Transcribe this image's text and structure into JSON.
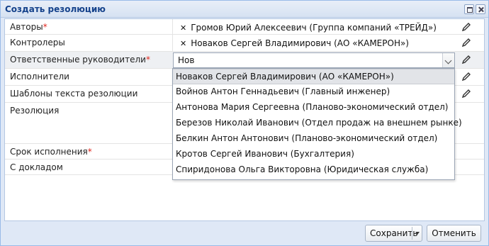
{
  "window": {
    "title": "Создать резолюцию"
  },
  "form": {
    "rows": [
      {
        "label": "Авторы",
        "required": true,
        "value": "Громов Юрий Алексеевич (Группа компаний «ТРЕЙД»)"
      },
      {
        "label": "Контролеры",
        "required": false,
        "value": "Новаков Сергей Владимирович (АО «КАМЕРОН»)"
      },
      {
        "label": "Ответственные руководители",
        "required": true,
        "input_value": "Нов"
      },
      {
        "label": "Исполнители",
        "required": false
      },
      {
        "label": "Шаблоны текста резолюции",
        "required": false
      },
      {
        "label": "Резолюция",
        "required": false
      },
      {
        "label": "Срок исполнения",
        "required": true
      },
      {
        "label": "С докладом",
        "required": false
      }
    ],
    "required_mark": "*"
  },
  "dropdown": {
    "options": [
      "Новаков Сергей Владимирович (АО «КАМЕРОН»)",
      "Войнов Антон Геннадьевич (Главный инженер)",
      "Антонова Мария Сергеевна (Планово-экономический отдел)",
      "Березов Николай Иванович (Отдел продаж на внешнем рынке)",
      "Белкин Антон Антонович (Планово-экономический отдел)",
      "Кротов Сергей Иванович (Бухгалтерия)",
      "Спиридонова Ольга Викторовна (Юридическая служба)"
    ],
    "selected_index": 0
  },
  "footer": {
    "save_label": "Сохранить",
    "cancel_label": "Отменить"
  },
  "icons": {
    "remove": "close-icon",
    "edit": "pencil-icon",
    "dropdown": "chevron-down-icon"
  },
  "colors": {
    "title_text": "#15428b",
    "required": "#e0241c",
    "window_border": "#99bbe8"
  }
}
